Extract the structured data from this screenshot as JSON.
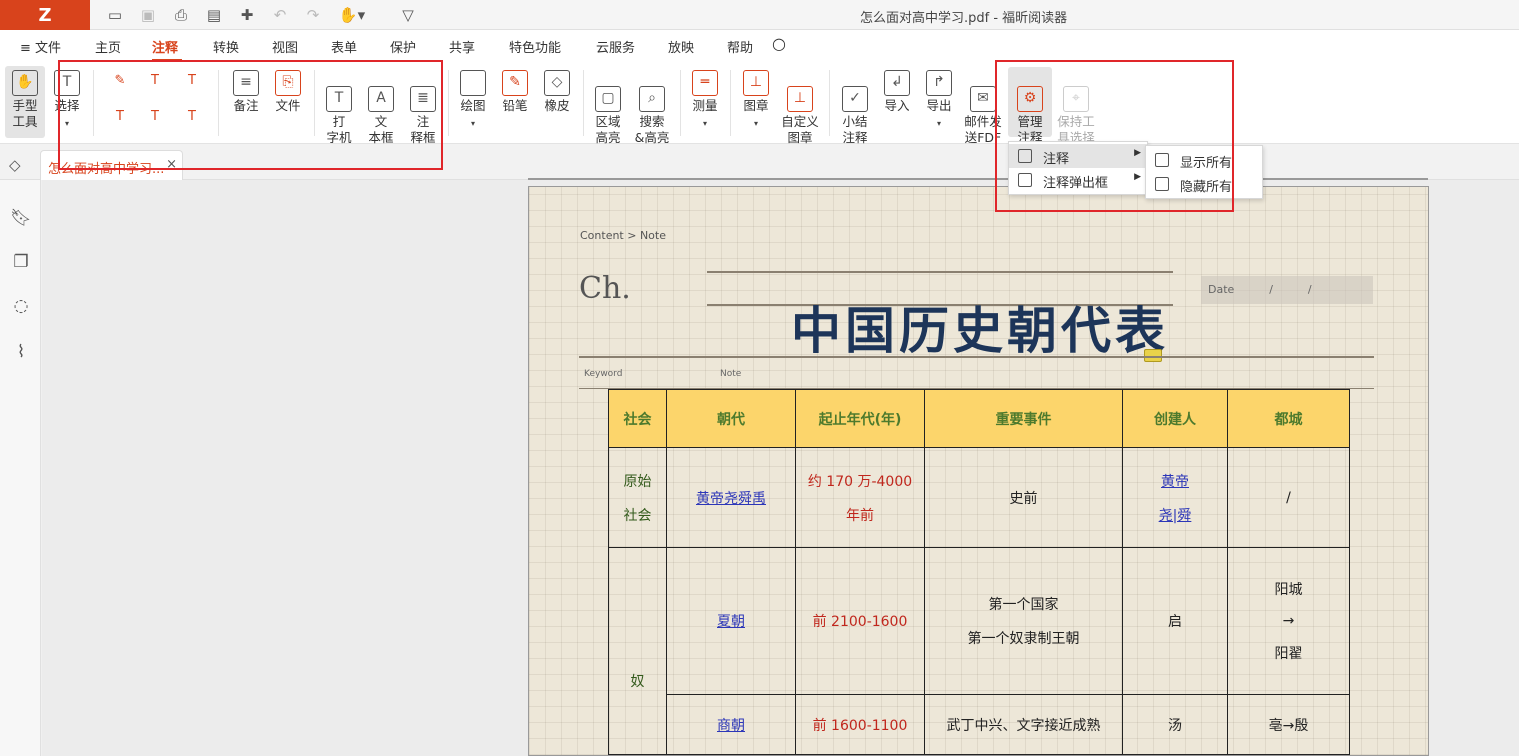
{
  "window": {
    "title": "怎么面对高中学习.pdf - 福昕阅读器",
    "logo": "Z"
  },
  "menubar": {
    "items": [
      "≡ 文件",
      "主页",
      "注释",
      "转换",
      "视图",
      "表单",
      "保护",
      "共享",
      "特色功能",
      "云服务",
      "放映",
      "帮助"
    ],
    "active": "注释",
    "search_icon": "search-icon"
  },
  "ribbon": {
    "hand": "手型\n工具",
    "select": "选择",
    "note": "备注",
    "file": "文件",
    "typewriter": "打\n字机",
    "textbox": "文\n本框",
    "callout": "注\n释框",
    "draw": "绘图",
    "pencil": "铅笔",
    "eraser": "橡皮",
    "area_highlight": "区域\n高亮",
    "search_highlight": "搜索\n&高亮",
    "measure": "测量",
    "stamp": "图章",
    "custom_stamp": "自定义\n图章",
    "summary": "小结\n注释",
    "import": "导入",
    "export": "导出",
    "email_fdf": "邮件发\n送FDF",
    "manage": "管理\n注释",
    "keep_tool": "保持工\n具选择"
  },
  "tabs": {
    "doc_tab": "怎么面对高中学习...",
    "close": "×"
  },
  "dropdown": {
    "main": [
      {
        "label": "注释",
        "highlighted": true
      },
      {
        "label": "注释弹出框",
        "highlighted": false
      }
    ],
    "sub": [
      "显示所有",
      "隐藏所有"
    ]
  },
  "document": {
    "breadcrumb": "Content > Note",
    "ch": "Ch.",
    "date": "Date          /          /",
    "title": "中国历史朝代表",
    "keyword": "Keyword",
    "note": "Note",
    "table": {
      "headers": [
        "社会",
        "朝代",
        "起止年代(年)",
        "重要事件",
        "创建人",
        "都城"
      ],
      "rows": [
        {
          "society": [
            "原始",
            "社会"
          ],
          "dynasty": "黄帝尧舜禹",
          "years": [
            "约 170 万-4000",
            "年前"
          ],
          "event": [
            "史前"
          ],
          "founder": [
            "黄帝",
            "尧|舜"
          ],
          "capital": [
            "/"
          ]
        },
        {
          "society": [],
          "dynasty": "夏朝",
          "years": [
            "前 2100-1600"
          ],
          "event": [
            "第一个国家",
            "第一个奴隶制王朝"
          ],
          "founder": [
            "启"
          ],
          "capital": [
            "阳城",
            "→",
            "阳翟"
          ]
        },
        {
          "society": [
            "奴"
          ],
          "dynasty": "商朝",
          "years": [
            "前 1600-1100"
          ],
          "event": [
            "武丁中兴、文字接近成熟"
          ],
          "founder": [
            "汤"
          ],
          "capital": [
            "亳→殷"
          ]
        }
      ]
    }
  },
  "colors": {
    "accent": "#d8431c",
    "title_blue": "#1d3559",
    "header_yellow": "#fcd56b",
    "highlight_box": "#e0262a"
  }
}
